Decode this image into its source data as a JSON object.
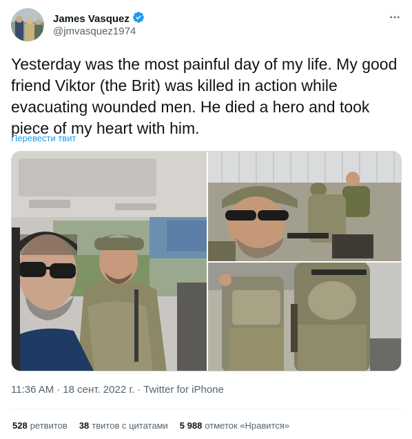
{
  "author": {
    "name": "James Vasquez",
    "handle": "@jmvasquez1974",
    "verified_icon": "verified-badge-icon",
    "verified_color": "#1d9bf0"
  },
  "tweet": {
    "text": "Yesterday was the most painful day of my life. My good friend Viktor (the Brit) was killed in action while evacuating wounded men. He died a hero and took piece of my heart with him.",
    "translate_label": "Перевести твит"
  },
  "meta": {
    "time": "11:36 AM",
    "separator1": "·",
    "date": "18 сент. 2022 г.",
    "separator2": "·",
    "source": "Twitter for iPhone"
  },
  "stats": {
    "retweets_count": "528",
    "retweets_label": "ретвитов",
    "quotes_count": "38",
    "quotes_label": "твитов с цитатами",
    "likes_count": "5 988",
    "likes_label": "отметок «Нравится»"
  },
  "colors": {
    "accent": "#1d9bf0",
    "secondary_text": "#536471",
    "primary_text": "#0f1419"
  }
}
